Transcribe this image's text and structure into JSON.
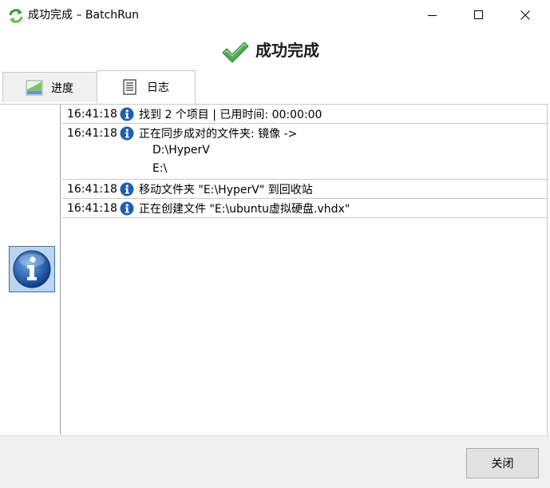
{
  "window": {
    "title": "成功完成 – BatchRun",
    "app_icon": "sync-arrows-icon",
    "controls": [
      "minimize-icon",
      "maximize-icon",
      "close-icon"
    ]
  },
  "header": {
    "icon": "checkmark-icon",
    "title": "成功完成",
    "icon_color": "#4caf50"
  },
  "tabs": [
    {
      "label": "进度",
      "icon": "progress-chart-icon",
      "selected": false
    },
    {
      "label": "日志",
      "icon": "log-list-icon",
      "selected": true
    }
  ],
  "log": {
    "entries": [
      {
        "time": "16:41:18",
        "icon": "info-icon",
        "text": "找到 2 个项目 | 已用时间: 00:00:00",
        "continuation": []
      },
      {
        "time": "16:41:18",
        "icon": "info-icon",
        "text": "正在同步成对的文件夹: 镜像 ->",
        "continuation": [
          "D:\\HyperV",
          "E:\\"
        ]
      },
      {
        "time": "16:41:18",
        "icon": "info-icon",
        "text": "移动文件夹 \"E:\\HyperV\" 到回收站",
        "continuation": []
      },
      {
        "time": "16:41:18",
        "icon": "info-icon",
        "text": "正在创建文件 \"E:\\ubuntu虚拟硬盘.vhdx\"",
        "continuation": []
      }
    ]
  },
  "side_panel": {
    "icon": "info-large-icon"
  },
  "footer": {
    "close_label": "关闭"
  },
  "colors": {
    "info_blue": "#1e5fb4",
    "accent_green": "#4caf50"
  }
}
